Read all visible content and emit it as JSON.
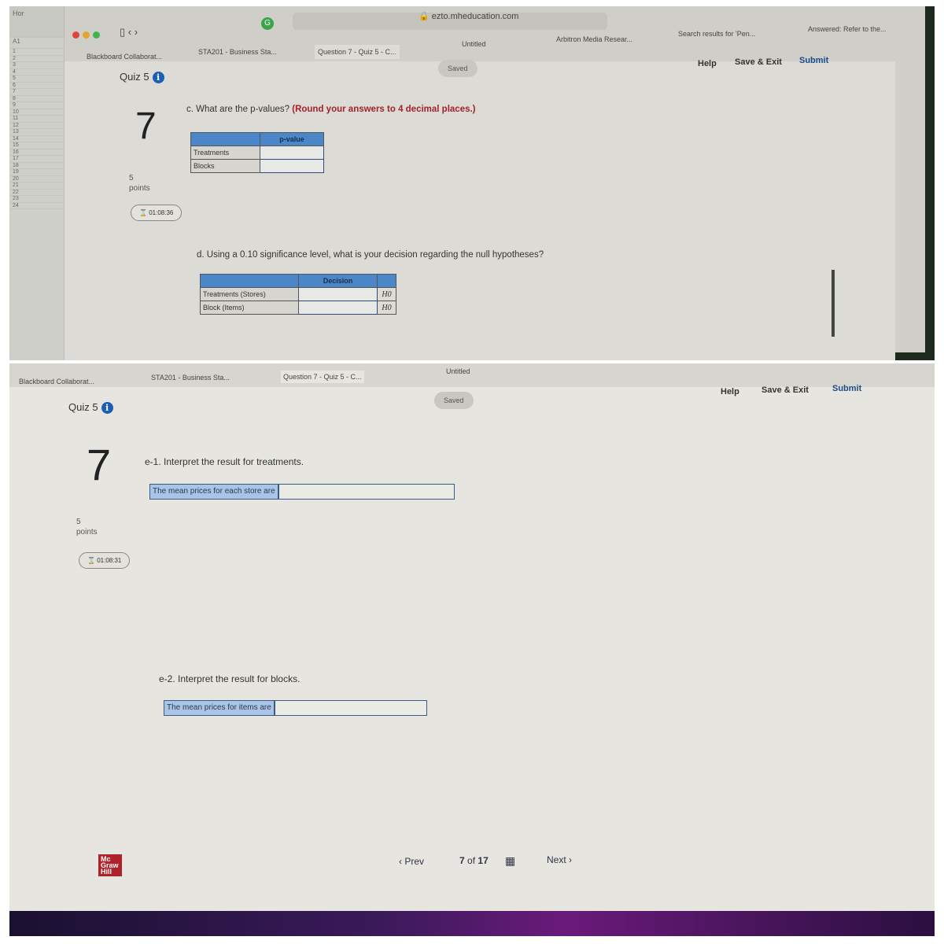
{
  "top": {
    "address_bar": "ezto.mheducation.com",
    "tabs": [
      "Blackboard Collaborat...",
      "STA201 - Business Sta...",
      "Question 7 - Quiz 5 - C...",
      "Untitled",
      "Arbitron Media Resear...",
      "Search results for 'Pen...",
      "Answered: Refer to the..."
    ],
    "spreadsheet_cell": "A1",
    "nav": {
      "help": "Help",
      "save_exit": "Save & Exit",
      "submit": "Submit",
      "saved": "Saved"
    },
    "quiz_title": "Quiz 5",
    "question_number": "7",
    "points_value": "5",
    "points_label": "points",
    "timer": "01:08:36",
    "part_c": {
      "question": "c. What are the p-values?",
      "instruction": "(Round your answers to 4 decimal places.)",
      "column_header": "p-value",
      "rows": [
        "Treatments",
        "Blocks"
      ]
    },
    "part_d": {
      "question": "d. Using a 0.10 significance level, what is your decision regarding the null hypotheses?",
      "column_header": "Decision",
      "rows": [
        {
          "label": "Treatments (Stores)",
          "suffix": "H0"
        },
        {
          "label": "Block (Items)",
          "suffix": "H0"
        }
      ]
    }
  },
  "bottom": {
    "tabs": [
      "Blackboard Collaborat...",
      "STA201 - Business Sta...",
      "Question 7 - Quiz 5 - C...",
      "Untitled"
    ],
    "nav": {
      "help": "Help",
      "save_exit": "Save & Exit",
      "submit": "Submit",
      "saved": "Saved"
    },
    "quiz_title": "Quiz 5",
    "question_number": "7",
    "points_value": "5",
    "points_label": "points",
    "timer": "01:08:31",
    "part_e1": {
      "question": "e-1. Interpret the result for treatments.",
      "prefix": "The mean prices for each store are"
    },
    "part_e2": {
      "question": "e-2. Interpret the result for blocks.",
      "prefix": "The mean prices for items are"
    },
    "pager": {
      "prev": "Prev",
      "current": "7",
      "of": "of",
      "total": "17",
      "next": "Next"
    },
    "logo": "Mc Graw Hill"
  }
}
